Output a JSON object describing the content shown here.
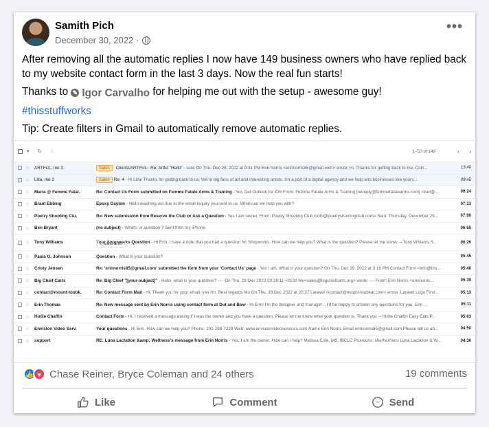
{
  "post": {
    "author": "Samith Pich",
    "date": "December 30, 2022",
    "dot": "·",
    "menu": "•••",
    "text1": "After removing all the automatic replies I now have 149 business owners who have replied back to my website contact form in the last 3 days. Now the real fun starts!",
    "thanks_pre": "Thanks to",
    "tagged": "Igor Carvalho",
    "thanks_post": "for helping me out with the setup - awesome guy!",
    "hashtag": "#thisstuffworks",
    "tip": "Tip: Create filters in Gmail to automatically remove automatic replies."
  },
  "gmail": {
    "range": "1–50 of 149",
    "rows": [
      {
        "sender": "ARTFUL, me 3",
        "labels": [
          "Sales",
          "Clients/ARTFUL"
        ],
        "subject": "Re: Artful \"Hello\"",
        "snippet": " - sure On Thu, Dec 29, 2022 at 9:31 PM Erin Norris <erinnorris85@gmail.com> wrote: Hi, Thanks for getting back to me. Coin...",
        "time": "13:40",
        "read": true
      },
      {
        "sender": "Lilla, me 2",
        "labels": [
          "Sales"
        ],
        "subject": "Re: 4",
        "snippet": " - Hi Lilla! Thanks for getting back to us. We're big fans of art and interesting artists. I'm a part of a digital agency and we help arts businesses like yours...",
        "time": "09:45",
        "read": true
      },
      {
        "sender": "Maria @ Femme Fatal.",
        "labels": [],
        "subject": "Re: Contact Us Form submitted on Femme Fatale Arms & Training",
        "snippet": " - Yes Get Outlook for iOS From: Femme Fatale Arms & Training [noreply@femmefatalearms.com] <karl@...",
        "time": "09:24",
        "read": false
      },
      {
        "sender": "Brant Ebbing",
        "labels": [],
        "subject": "Epoxy Dayton",
        "snippet": " - Hello reaching out due to the email inquiry you sent to us. What can we help you with?",
        "time": "07:13",
        "read": false
      },
      {
        "sender": "Poetry Shooting Clu.",
        "labels": [],
        "subject": "Re: New submission from Reserve the Club or Ask a Question",
        "snippet": " - Yes I am owner. From: Poetry Shooting Club <info@poetryshootingclub.com> Sent: Thursday, December 29...",
        "time": "07:06",
        "read": false
      },
      {
        "sender": "Ben Bryant",
        "labels": [],
        "subject": "(no subject)",
        "snippet": " - What's ur question ? Sent from my iPhone",
        "time": "06:55",
        "read": false
      },
      {
        "sender": "Tony Williams",
        "labels": [],
        "subject": "Your Shopworks Question",
        "snippet": " - Hi Erin, I have a note that you had a question for Shopworks. How can we help you? What is the question? Please let me know. -- Tony Williams S...",
        "time": "06:26",
        "read": false,
        "attachment": "t_williams.vcf"
      },
      {
        "sender": "Paula G. Johnson",
        "labels": [],
        "subject": "Question",
        "snippet": " - What is your question?",
        "time": "05:45",
        "read": false
      },
      {
        "sender": "Cristy Jensen",
        "labels": [],
        "subject": "Re: 'erinnorris85@gmail.com' submitted the form from your 'Contact Us' page",
        "snippet": " - Yes I am. What is your question? On Thu, Dec 29, 2022 at 3:18 PM Contact Form <info@blu...",
        "time": "05:40",
        "read": false
      },
      {
        "sender": "Big Chief Carts",
        "labels": [],
        "subject": "Re: Big Chief \"[your-subject]\"",
        "snippet": " - Hello, what is your question? ---- On Thu, 29 Dec 2022 20:28:11 +0100 Me<sales@bigchiefcarts.org> wrote ---- From: Erin Norris <erinnorris...",
        "time": "05:39",
        "read": false
      },
      {
        "sender": "contact@mount-toubk.",
        "labels": [],
        "subject": "Re: Contact Form Mail",
        "snippet": " - Hi, Thank you for your email, yes I'm. Best regards Mo On Thu, 29 Dec 2022 at 20:37 Laravel <contact@mount-toubkal.com> wrote: Laravel Logo First...",
        "time": "05:13",
        "read": false
      },
      {
        "sender": "Erin Thomas",
        "labels": [],
        "subject": "Re: New message sent by Erin Norris using contact form at Dot and Bow",
        "snippet": " - Hi Erin! I'm the designer and manager... I'd be happy to answer any questions for you. Erin ...",
        "time": "05:11",
        "read": false
      },
      {
        "sender": "Hollie Chaffin",
        "labels": [],
        "subject": "Contact Form",
        "snippet": " - Hi, I received a message asking if I was the owner and you have a question. Please let me know what your question is. Thank you -- Hollie Chaffin Easy Eats P...",
        "time": "05:03",
        "read": false
      },
      {
        "sender": "Envision Video Serv.",
        "labels": [],
        "subject": "Your questions",
        "snippet": " - Hi Erin, How can we help you? Phone: 201-288-7228 Web: www.envisionvideoservices.com Name Erin Norris Email erinnorris85@gmail.com Please tell us ab...",
        "time": "04:50",
        "read": false
      },
      {
        "sender": "support",
        "labels": [],
        "subject": "RE: Luna Lactation &amp; Wellness's message from Erin Norris",
        "snippet": " - Yes, I am the owner. How can I help? Melissa Cole, MS, IBCLC Pronouns: she/her/hers Luna Lactation & W...",
        "time": "04:36",
        "read": false
      }
    ]
  },
  "reactions": {
    "names": "Chase Reiner, Bryce Coleman and 24 others",
    "comments": "19 comments",
    "like_glyph": "👍",
    "love_glyph": "♥"
  },
  "actions": {
    "like": "Like",
    "comment": "Comment",
    "send": "Send"
  }
}
